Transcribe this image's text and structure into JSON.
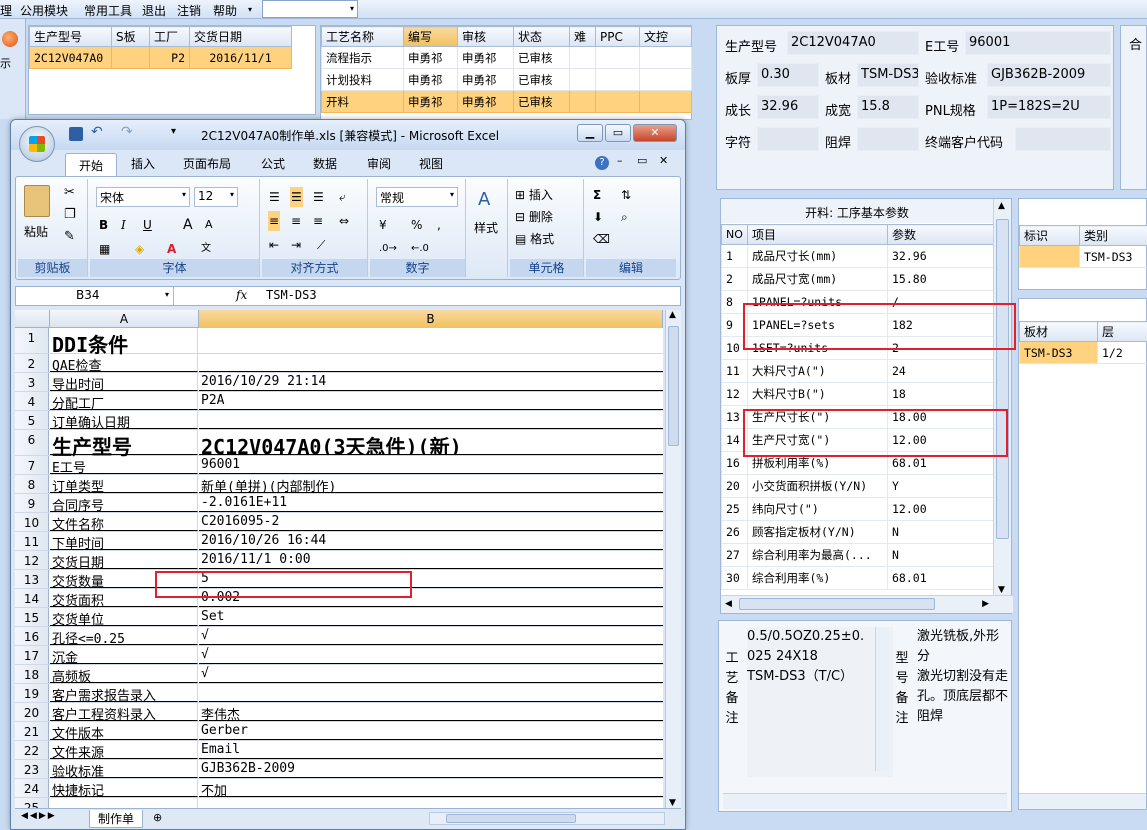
{
  "menubar": {
    "items": [
      "理",
      "公用模块",
      "常用工具",
      "退出",
      "注销",
      "帮助"
    ],
    "dropdown_arrow": "▾"
  },
  "left_sliver": {
    "label": "示"
  },
  "order_grid": {
    "headers": [
      "生产型号",
      "S板",
      "工厂",
      "交货日期"
    ],
    "rows": [
      [
        "2C12V047A0",
        "",
        "P2",
        "2016/11/1"
      ]
    ]
  },
  "process_grid": {
    "headers": [
      "工艺名称",
      "编写",
      "审核",
      "状态",
      "难",
      "PPC",
      "文控"
    ],
    "rows": [
      [
        "流程指示",
        "申勇祁",
        "申勇祁",
        "已审核",
        "",
        "",
        ""
      ],
      [
        "计划投料",
        "申勇祁",
        "申勇祁",
        "已审核",
        "",
        "",
        ""
      ],
      [
        "开料",
        "申勇祁",
        "申勇祁",
        "已审核",
        "",
        "",
        ""
      ]
    ]
  },
  "info": {
    "model_label": "生产型号",
    "model_value": "2C12V047A0",
    "eno_label": "E工号",
    "eno_value": "96001",
    "thickness_label": "板厚",
    "thickness_value": "0.30",
    "material_label": "板材",
    "material_value": "TSM-DS3",
    "standard_label": "验收标准",
    "standard_value": "GJB362B-2009",
    "length_label": "成长",
    "length_value": "32.96",
    "width_label": "成宽",
    "width_value": "15.8",
    "pnl_label": "PNL规格",
    "pnl_value": "1P=182S=2U",
    "char_label": "字符",
    "char_value": "",
    "mask_label": "阻焊",
    "mask_value": "",
    "customer_label": "终端客户代码",
    "customer_value": "",
    "right_sliver_label": "合"
  },
  "param_panel": {
    "title": "开料: 工序基本参数",
    "headers": [
      "NO",
      "项目",
      "参数"
    ],
    "rows": [
      [
        "1",
        "成品尺寸长(mm)",
        "32.96"
      ],
      [
        "2",
        "成品尺寸宽(mm)",
        "15.80"
      ],
      [
        "8",
        "1PANEL=?units",
        "/"
      ],
      [
        "9",
        "1PANEL=?sets",
        "182"
      ],
      [
        "10",
        "1SET=?units",
        "2"
      ],
      [
        "11",
        "大料尺寸A(\")",
        "24"
      ],
      [
        "12",
        "大料尺寸B(\")",
        "18"
      ],
      [
        "13",
        "生产尺寸长(\")",
        "18.00"
      ],
      [
        "14",
        "生产尺寸宽(\")",
        "12.00"
      ],
      [
        "16",
        "拼板利用率(%)",
        "68.01"
      ],
      [
        "20",
        "小交货面积拼板(Y/N)",
        "Y"
      ],
      [
        "25",
        "纬向尺寸(\")",
        "12.00"
      ],
      [
        "26",
        "顾客指定板材(Y/N)",
        "N"
      ],
      [
        "27",
        "综合利用率为最高(...",
        "N"
      ],
      [
        "30",
        "综合利用率(%)",
        "68.01"
      ]
    ]
  },
  "remarks": {
    "process_label": "工艺备注",
    "process_text": "0.5/0.5OZ0.25±0.\n025 24X18\nTSM-DS3（T/C）",
    "model_label": "型号备注",
    "model_text": "激光铣板,外形分\n激光切割没有走\n孔。顶底层都不\n阻焊"
  },
  "mark_grid": {
    "headers": [
      "标识",
      "类别"
    ],
    "rows": [
      [
        "",
        "TSM-DS3"
      ]
    ]
  },
  "board_grid": {
    "headers": [
      "板材",
      "层"
    ],
    "rows": [
      [
        "TSM-DS3",
        "1/2"
      ]
    ]
  },
  "excel": {
    "title": "2C12V047A0制作单.xls  [兼容模式] - Microsoft Excel",
    "tabs": [
      "开始",
      "插入",
      "页面布局",
      "公式",
      "数据",
      "审阅",
      "视图"
    ],
    "ribbon": {
      "paste": "粘贴",
      "clipboard": "剪贴板",
      "font_name": "宋体",
      "font_size": "12",
      "font": "字体",
      "alignment": "对齐方式",
      "number_format": "常规",
      "number": "数字",
      "styles": "样式",
      "insert": "插入",
      "delete": "删除",
      "format": "格式",
      "cells": "单元格",
      "editing": "编辑",
      "bold": "B",
      "italic": "I",
      "underline": "U",
      "percent": "%",
      "comma": ",",
      "grow_font": "A",
      "shrink_font": "A"
    },
    "name_box": "B34",
    "fx": "fx",
    "formula_value": "TSM-DS3",
    "col_a": "A",
    "col_b": "B",
    "rows": [
      {
        "n": "1",
        "a": "DDI条件",
        "b": ""
      },
      {
        "n": "2",
        "a": "QAE检查",
        "b": ""
      },
      {
        "n": "3",
        "a": "导出时间",
        "b": "2016/10/29 21:14"
      },
      {
        "n": "4",
        "a": "分配工厂",
        "b": "P2A"
      },
      {
        "n": "5",
        "a": "订单确认日期",
        "b": ""
      },
      {
        "n": "6",
        "a": "生产型号",
        "b": "2C12V047A0(3天急件)(新)"
      },
      {
        "n": "7",
        "a": "E工号",
        "b": "96001"
      },
      {
        "n": "8",
        "a": "订单类型",
        "b": "新单(单拼)(内部制作)"
      },
      {
        "n": "9",
        "a": "合同序号",
        "b": "-2.0161E+11"
      },
      {
        "n": "10",
        "a": "文件名称",
        "b": "C2016095-2"
      },
      {
        "n": "11",
        "a": "下单时间",
        "b": "2016/10/26 16:44"
      },
      {
        "n": "12",
        "a": "交货日期",
        "b": "2016/11/1 0:00"
      },
      {
        "n": "13",
        "a": "交货数量",
        "b": "5"
      },
      {
        "n": "14",
        "a": "交货面积",
        "b": "0.002"
      },
      {
        "n": "15",
        "a": "交货单位",
        "b": "Set"
      },
      {
        "n": "16",
        "a": "孔径<=0.25",
        "b": "√"
      },
      {
        "n": "17",
        "a": "沉金",
        "b": "√"
      },
      {
        "n": "18",
        "a": "高频板",
        "b": "√"
      },
      {
        "n": "19",
        "a": "客户需求报告录入",
        "b": ""
      },
      {
        "n": "20",
        "a": "客户工程资料录入",
        "b": "李伟杰"
      },
      {
        "n": "21",
        "a": "文件版本",
        "b": "Gerber"
      },
      {
        "n": "22",
        "a": "文件来源",
        "b": "Email"
      },
      {
        "n": "23",
        "a": "验收标准",
        "b": "GJB362B-2009"
      },
      {
        "n": "24",
        "a": "快捷标记",
        "b": "不加"
      },
      {
        "n": "25",
        "a": "",
        "b": ""
      }
    ],
    "sheet_tab": "制作单"
  },
  "colors": {
    "selection": "#ffd27f",
    "annotation": "#e0212b",
    "header_blue": "#15428b"
  }
}
